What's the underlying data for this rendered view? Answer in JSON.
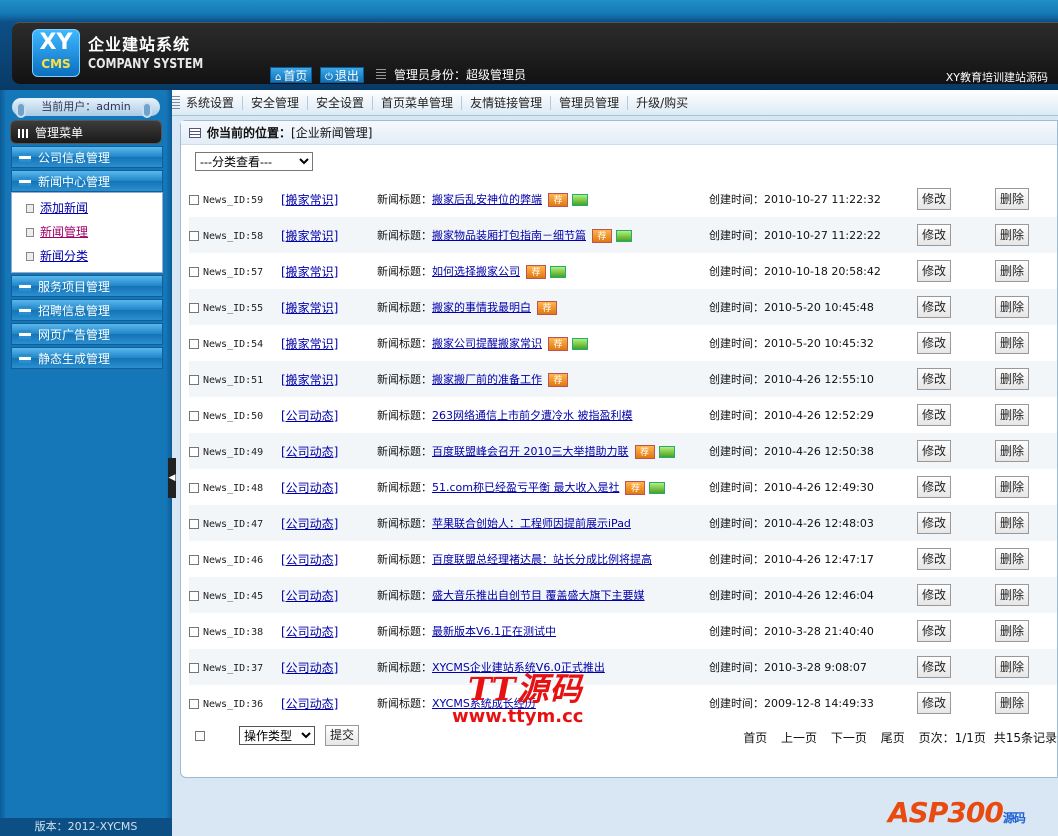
{
  "header": {
    "logo_xy": "XY",
    "logo_cms": "CMS",
    "brand_cn": "企业建站系统",
    "brand_en": "COMPANY SYSTEM",
    "home_label": "首页",
    "logout_label": "退出",
    "admin_identity": "管理员身份：超级管理员",
    "site_source": "XY教育培训建站源码"
  },
  "sidebar": {
    "current_user": "当前用户：admin",
    "menu_title": "管理菜单",
    "cat_company": "公司信息管理",
    "cat_news": "新闻中心管理",
    "sub_add": "添加新闻",
    "sub_manage": "新闻管理",
    "sub_category": "新闻分类",
    "cat_service": "服务项目管理",
    "cat_jobs": "招聘信息管理",
    "cat_ads": "网页广告管理",
    "cat_static": "静态生成管理",
    "version": "版本：2012-XYCMS"
  },
  "topnav": {
    "items": [
      "系统设置",
      "安全管理",
      "安全设置",
      "首页菜单管理",
      "友情链接管理",
      "管理员管理",
      "升级/购买"
    ]
  },
  "content": {
    "breadcrumb_label": "你当前的位置：",
    "breadcrumb_value": "[企业新闻管理]",
    "category_filter": "---分类查看---",
    "title_prefix": "新闻标题：",
    "time_prefix": "创建时间：",
    "edit_label": "修改",
    "delete_label": "删除",
    "rec_badge": "荐",
    "rows": [
      {
        "id": "News_ID:59",
        "cat": "[搬家常识]",
        "title": "搬家后乱安神位的弊端",
        "time": "2010-10-27 11:22:32",
        "rec": true,
        "img": true
      },
      {
        "id": "News_ID:58",
        "cat": "[搬家常识]",
        "title": "搬家物品装厢打包指南－细节篇",
        "time": "2010-10-27 11:22:22",
        "rec": true,
        "img": true
      },
      {
        "id": "News_ID:57",
        "cat": "[搬家常识]",
        "title": "如何选择搬家公司",
        "time": "2010-10-18 20:58:42",
        "rec": true,
        "img": true
      },
      {
        "id": "News_ID:55",
        "cat": "[搬家常识]",
        "title": "搬家的事情我最明白",
        "time": "2010-5-20 10:45:48",
        "rec": true,
        "img": false
      },
      {
        "id": "News_ID:54",
        "cat": "[搬家常识]",
        "title": "搬家公司提醒搬家常识",
        "time": "2010-5-20 10:45:32",
        "rec": true,
        "img": true
      },
      {
        "id": "News_ID:51",
        "cat": "[搬家常识]",
        "title": "搬家搬厂前的准备工作",
        "time": "2010-4-26 12:55:10",
        "rec": true,
        "img": false
      },
      {
        "id": "News_ID:50",
        "cat": "[公司动态]",
        "title": "263网络通信上市前夕遭冷水 被指盈利模",
        "time": "2010-4-26 12:52:29",
        "rec": false,
        "img": false
      },
      {
        "id": "News_ID:49",
        "cat": "[公司动态]",
        "title": "百度联盟峰会召开 2010三大举措助力联",
        "time": "2010-4-26 12:50:38",
        "rec": true,
        "img": true
      },
      {
        "id": "News_ID:48",
        "cat": "[公司动态]",
        "title": "51.com称已经盈亏平衡 最大收入是社",
        "time": "2010-4-26 12:49:30",
        "rec": true,
        "img": true
      },
      {
        "id": "News_ID:47",
        "cat": "[公司动态]",
        "title": "苹果联合创始人：工程师因提前展示iPad",
        "time": "2010-4-26 12:48:03",
        "rec": false,
        "img": false
      },
      {
        "id": "News_ID:46",
        "cat": "[公司动态]",
        "title": "百度联盟总经理褚达晨：站长分成比例将提高",
        "time": "2010-4-26 12:47:17",
        "rec": false,
        "img": false
      },
      {
        "id": "News_ID:45",
        "cat": "[公司动态]",
        "title": "盛大音乐推出自创节目 覆盖盛大旗下主要媒",
        "time": "2010-4-26 12:46:04",
        "rec": false,
        "img": false
      },
      {
        "id": "News_ID:38",
        "cat": "[公司动态]",
        "title": "最新版本V6.1正在测试中",
        "time": "2010-3-28 21:40:40",
        "rec": false,
        "img": false
      },
      {
        "id": "News_ID:37",
        "cat": "[公司动态]",
        "title": "XYCMS企业建站系统V6.0正式推出",
        "time": "2010-3-28 9:08:07",
        "rec": false,
        "img": false
      },
      {
        "id": "News_ID:36",
        "cat": "[公司动态]",
        "title": "XYCMS系统成长经历",
        "time": "2009-12-8 14:49:33",
        "rec": false,
        "img": false
      }
    ],
    "operation_type": "操作类型",
    "submit_label": "提交",
    "pager": {
      "first": "首页",
      "prev": "上一页",
      "next": "下一页",
      "last": "尾页",
      "page_info": "页次：1/1页",
      "total": "共15条记录"
    }
  },
  "watermark": {
    "tt_cn": "TT源码",
    "tt_url": "www.ttym.cc",
    "asp_logo": "ASP300",
    "asp_sub": "源码"
  }
}
